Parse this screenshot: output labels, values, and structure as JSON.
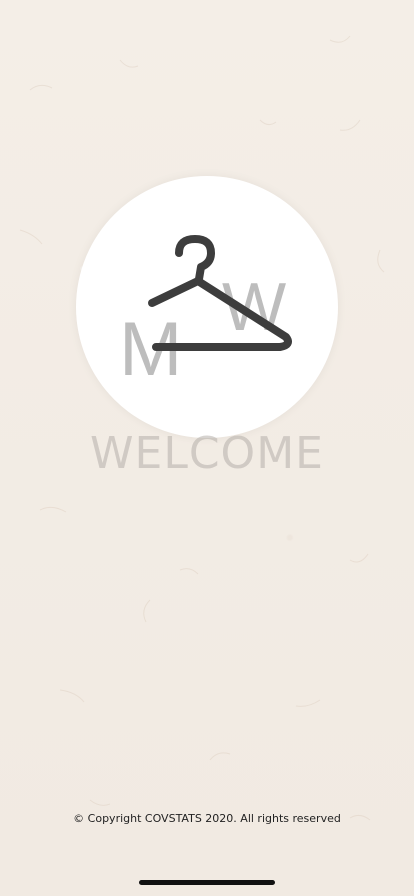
{
  "splash": {
    "logo": {
      "icon": "hanger-icon",
      "letter_left": "M",
      "letter_right": "W"
    },
    "welcome_text": "WELCOME",
    "copyright": "© Copyright COVSTATS 2020. All rights reserved"
  },
  "colors": {
    "background": "#f3ede6",
    "logo_circle": "#ffffff",
    "hanger": "#3d3d3d",
    "logo_letters": "#bdbdbd",
    "welcome": "#b4afaa"
  }
}
